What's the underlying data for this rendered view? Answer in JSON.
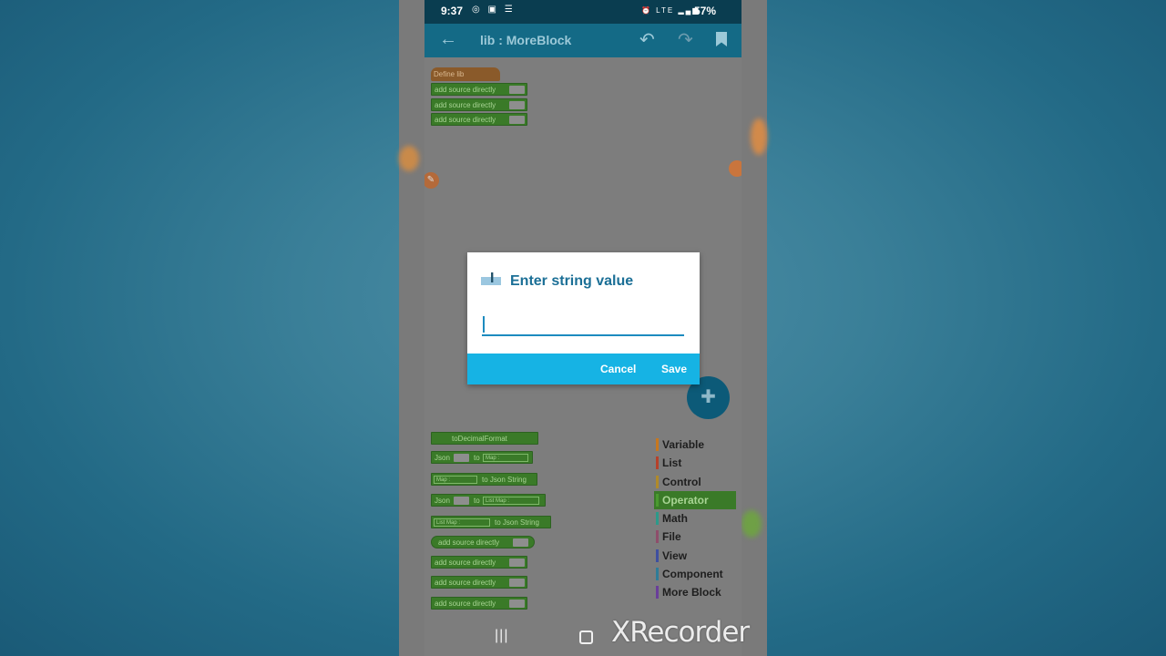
{
  "status_bar": {
    "time": "9:37",
    "left_icons": "◎ ▣ ☰",
    "right_icons": "⏰ LTE ▂▄▆",
    "battery": "57%"
  },
  "app_bar": {
    "title": "lib : MoreBlock",
    "back_icon": "arrow-left",
    "undo_icon": "undo",
    "redo_icon": "redo",
    "bookmark_icon": "bookmark"
  },
  "blocks": {
    "define_label": "Define lib",
    "top_stack": [
      "add source directly",
      "add source directly",
      "add source directly"
    ],
    "to_decimal": "toDecimalFormat",
    "json_label": "Json",
    "to_label": "to",
    "map_dd": "Map :",
    "to_json_string": "to Json String",
    "list_map_dd": "List Map :",
    "bottom_stack": [
      "add source directly",
      "add source directly",
      "add source directly",
      "add source directly"
    ]
  },
  "palette": {
    "items": [
      {
        "label": "Variable",
        "color": "#c7771e"
      },
      {
        "label": "List",
        "color": "#b6412a"
      },
      {
        "label": "Control",
        "color": "#b08a2a"
      },
      {
        "label": "Operator",
        "color": "#4a9a2f"
      },
      {
        "label": "Math",
        "color": "#2c9a8a"
      },
      {
        "label": "File",
        "color": "#8e4d6b"
      },
      {
        "label": "View",
        "color": "#3e4fa0"
      },
      {
        "label": "Component",
        "color": "#2e7c98"
      },
      {
        "label": "More Block",
        "color": "#6a3e9a"
      }
    ],
    "selected": "Operator"
  },
  "dialog": {
    "title": "Enter string value",
    "input_value": "",
    "cancel_label": "Cancel",
    "save_label": "Save"
  },
  "watermark": "XRecorder",
  "colors": {
    "accent": "#16b3e4",
    "app_bar": "#146a86",
    "block_green": "#3a7a28"
  }
}
